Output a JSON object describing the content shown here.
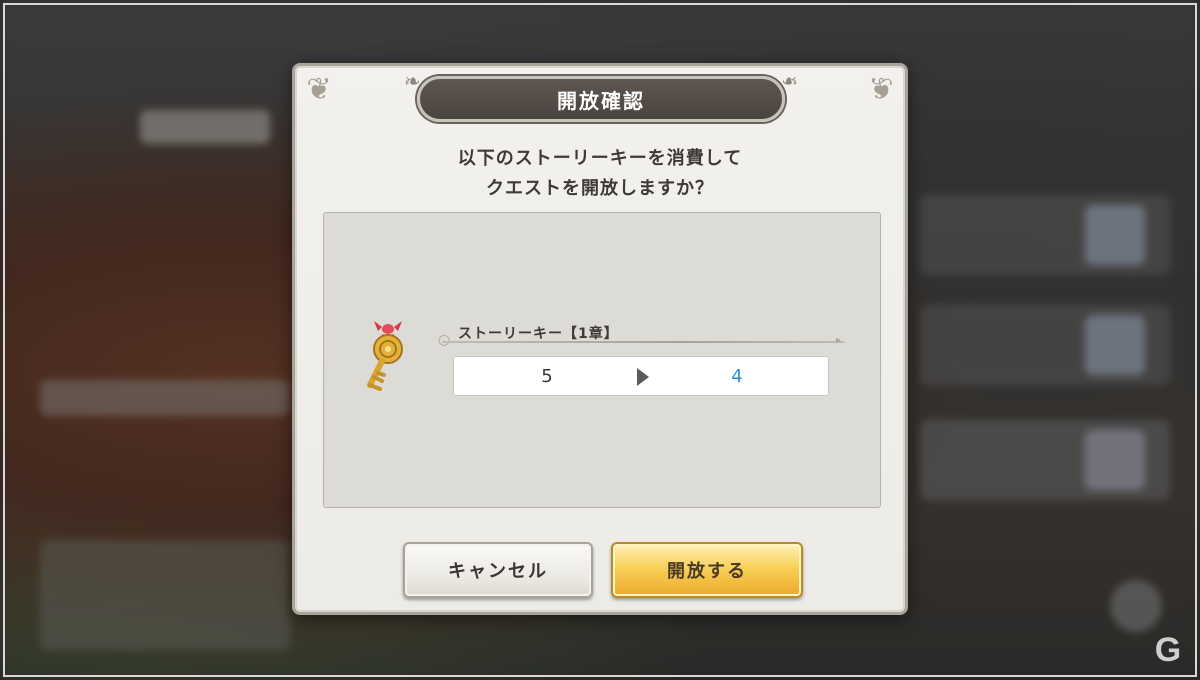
{
  "dialog": {
    "title": "開放確認",
    "message_line1": "以下のストーリーキーを消費して",
    "message_line2": "クエストを開放しますか？"
  },
  "item": {
    "name": "ストーリーキー【1章】",
    "icon": "golden-key-icon",
    "count_from": "5",
    "count_to": "4"
  },
  "buttons": {
    "cancel_label": "キャンセル",
    "open_label": "開放する"
  },
  "colors": {
    "accent_count": "#2f8ad8",
    "open_button": "#f8d15a",
    "title_plate": "#4a4440"
  },
  "watermark_icon": "gamer-logo-icon"
}
